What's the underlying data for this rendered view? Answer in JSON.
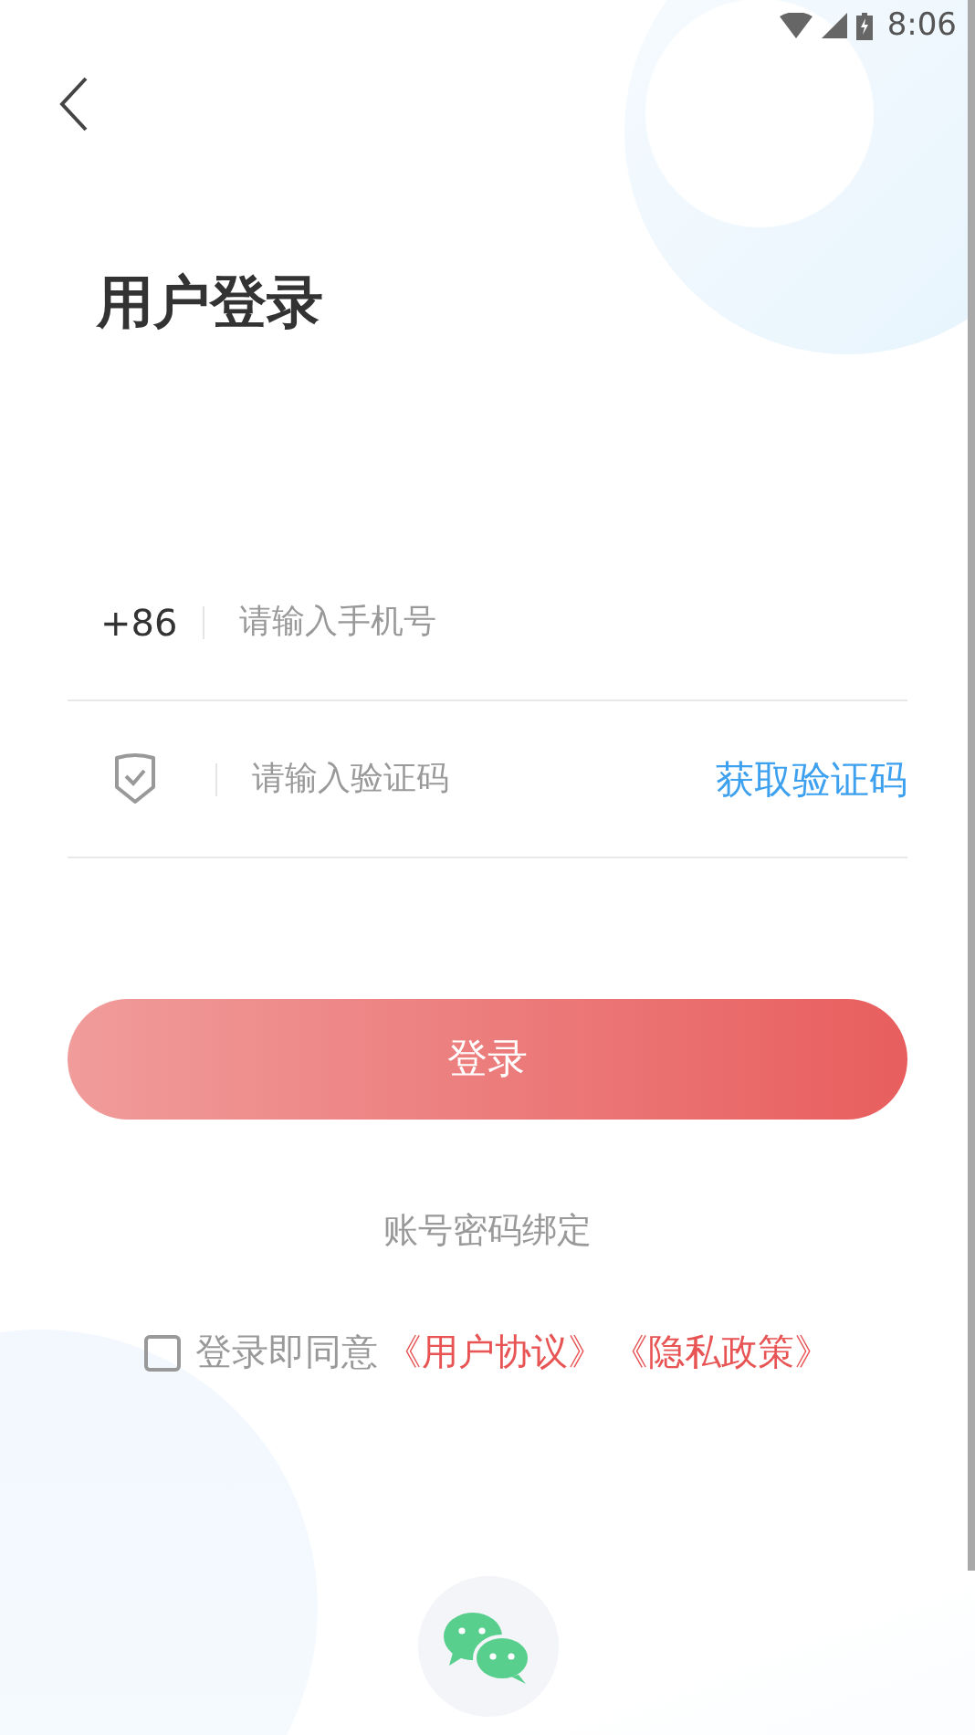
{
  "status_bar": {
    "time": "8:06"
  },
  "title": "用户登录",
  "phone_field": {
    "prefix": "+86",
    "placeholder": "请输入手机号"
  },
  "code_field": {
    "placeholder": "请输入验证码",
    "action": "获取验证码"
  },
  "login_button": "登录",
  "bind_link": "账号密码绑定",
  "agreement": {
    "checked": false,
    "text": "登录即同意",
    "links": [
      "《用户协议》",
      "《隐私政策》"
    ]
  }
}
